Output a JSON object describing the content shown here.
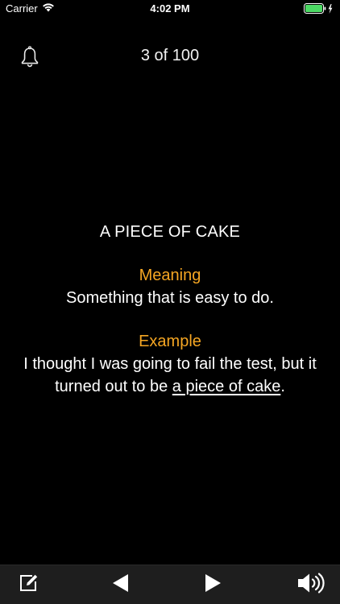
{
  "status_bar": {
    "carrier": "Carrier",
    "time": "4:02 PM",
    "wifi_icon": "wifi-icon",
    "battery_icon": "battery-charging-icon",
    "battery_color": "#4cd964"
  },
  "header": {
    "bell_icon": "bell-icon",
    "counter": "3 of 100"
  },
  "card": {
    "idiom": "A PIECE OF CAKE",
    "meaning_heading": "Meaning",
    "meaning_text": "Something that is easy to do.",
    "example_heading": "Example",
    "example_before": "I thought I was going to fail the test, but it turned out to be ",
    "example_highlight": "a piece of cake",
    "example_after": ".",
    "accent_color": "#f5a623"
  },
  "toolbar": {
    "edit_icon": "edit-icon",
    "prev_icon": "previous-icon",
    "next_icon": "next-icon",
    "sound_icon": "speaker-icon"
  }
}
